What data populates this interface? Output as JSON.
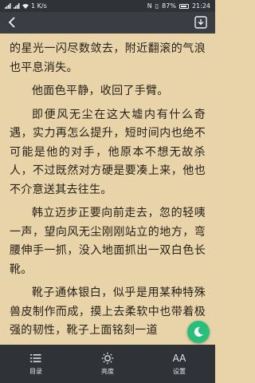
{
  "status": {
    "net_speed": "1 K/s",
    "battery": "87%",
    "time": "21:24"
  },
  "content": {
    "paragraphs": [
      "的星光一闪尽数敛去，附近翻滚的气浪也平息消失。",
      "他面色平静，收回了手臂。",
      "即便风无尘在这大墟内有什么奇遇，实力再怎么提升，短时间内也绝不可能是他的对手，他原本不想无故杀人，不过既然对方硬是要凑上来，他也不介意送其去往生。",
      "韩立迈步正要向前走去，忽的轻咦一声，望向风无尘刚刚站立的地方，弯腰伸手一抓，没入地面抓出一双白色长靴。",
      "靴子通体银白，似乎是用某种特殊兽皮制作而成，摸上去柔软中也带着极强的韧性，靴子上面铭刻一道"
    ]
  },
  "bottom_nav": {
    "toc": "目录",
    "brightness": "亮度",
    "settings": "设置",
    "settings_glyph": "AA"
  },
  "colors": {
    "page_bg": "#e9d3a9",
    "bar_bg": "#2f3236",
    "fab": "#27c07a"
  }
}
